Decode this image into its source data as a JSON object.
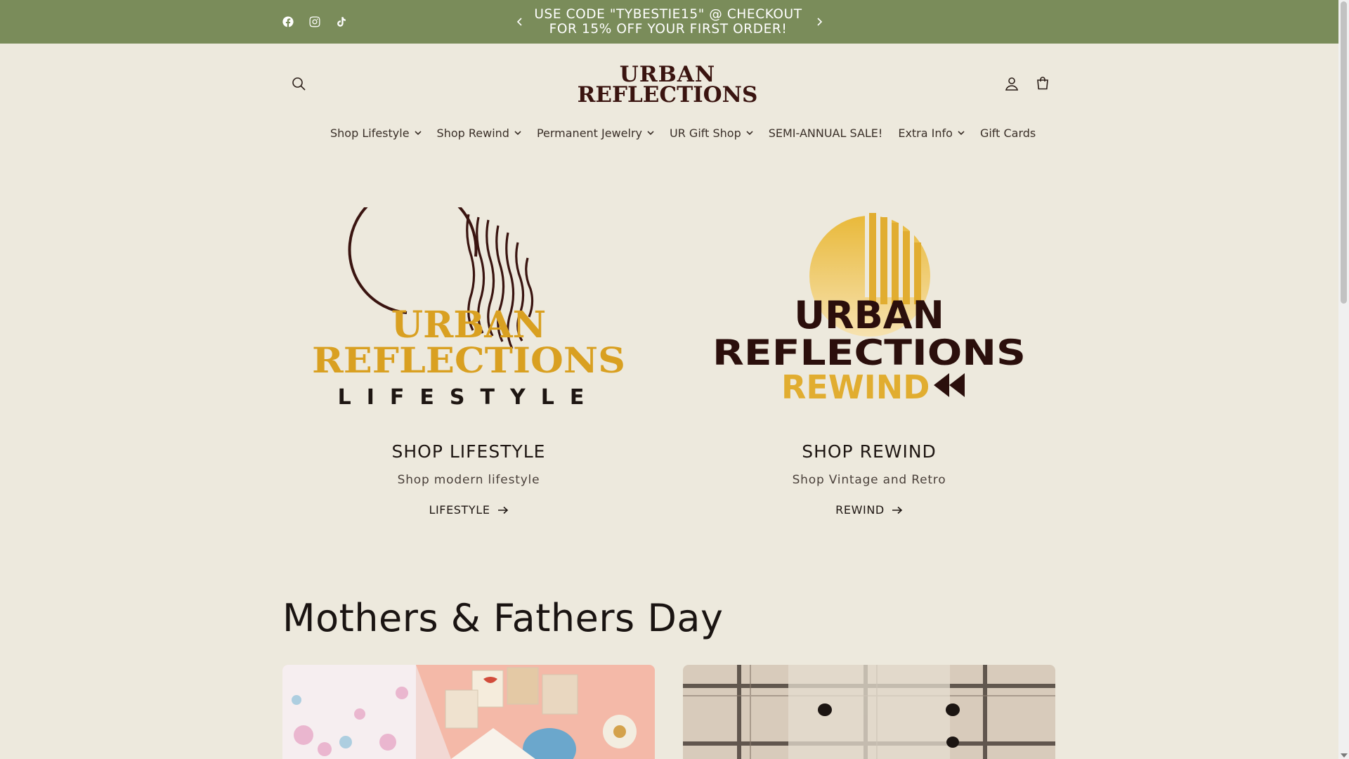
{
  "announcement": {
    "text": "USE CODE \"TYBESTIE15\" @ CHECKOUT FOR 15% OFF YOUR FIRST ORDER!",
    "prev_icon": "chevron-left-icon",
    "next_icon": "chevron-right-icon"
  },
  "social": [
    "facebook-icon",
    "instagram-icon",
    "tiktok-icon"
  ],
  "header": {
    "logo_line1": "URBAN",
    "logo_line2": "REFLECTIONS",
    "icons": [
      "search-icon",
      "account-icon",
      "cart-icon"
    ]
  },
  "nav": {
    "items": [
      {
        "label": "Shop Lifestyle",
        "dropdown": true
      },
      {
        "label": "Shop Rewind",
        "dropdown": true
      },
      {
        "label": "Permanent Jewelry",
        "dropdown": true
      },
      {
        "label": "UR Gift Shop",
        "dropdown": true
      },
      {
        "label": "SEMI-ANNUAL SALE!",
        "dropdown": false
      },
      {
        "label": "Extra Info",
        "dropdown": true
      },
      {
        "label": "Gift Cards",
        "dropdown": false
      }
    ]
  },
  "brands": [
    {
      "logo_top": "URBAN",
      "logo_mid": "REFLECTIONS",
      "logo_bottom": "LIFESTYLE",
      "title": "SHOP LIFESTYLE",
      "subtitle": "Shop modern lifestyle",
      "link": "LIFESTYLE"
    },
    {
      "logo_top": "URBAN",
      "logo_mid": "REFLECTIONS",
      "logo_bottom": "REWIND",
      "title": "SHOP REWIND",
      "subtitle": "Shop Vintage and Retro",
      "link": "REWIND"
    }
  ],
  "section": {
    "title": "Mothers & Fathers Day"
  },
  "colors": {
    "announcement_bg": "#7a8c5a",
    "page_bg": "#ede9dd",
    "brand_gold": "#d9a021",
    "brand_maroon": "#3a1410"
  }
}
